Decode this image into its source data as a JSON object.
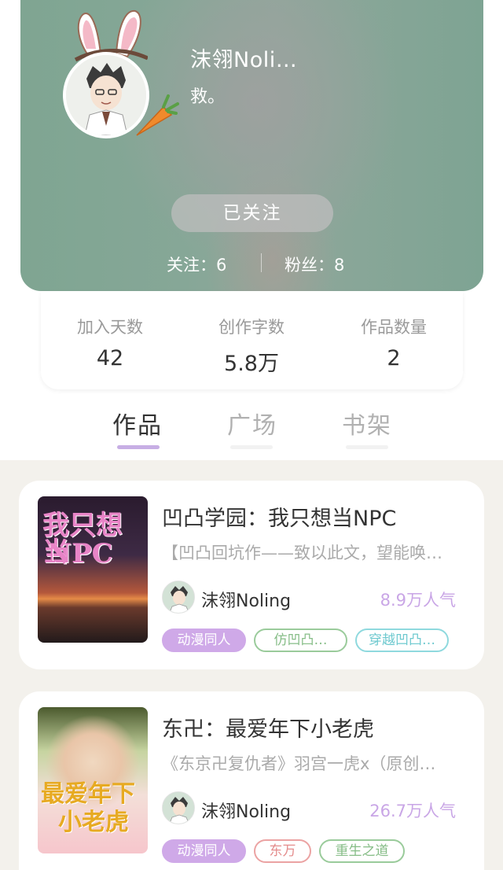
{
  "profile": {
    "name": "沫翎Noli…",
    "bio": "救。",
    "follow_button": "已关注",
    "following_text": "关注：6",
    "fans_text": "粉丝：8"
  },
  "stats": {
    "days_label": "加入天数",
    "days_value": "42",
    "words_label": "创作字数",
    "words_value": "5.8万",
    "works_label": "作品数量",
    "works_value": "2"
  },
  "tabs": [
    {
      "label": "作品",
      "active": true
    },
    {
      "label": "广场",
      "active": false
    },
    {
      "label": "书架",
      "active": false
    }
  ],
  "books": [
    {
      "title": "凹凸学园：我只想当NPC",
      "description": "【凹凸回坑作——致以此文，望能唤…",
      "author": "沫翎Noling",
      "popularity": "8.9万人气",
      "cover_text_1": "我只想当",
      "cover_text_2": "NPC",
      "tags": [
        "动漫同人",
        "仿凹凸…",
        "穿越凹凸…"
      ]
    },
    {
      "title": "东卍：最爱年下小老虎",
      "description": "《东京卍复仇者》羽宫一虎x（原创…",
      "author": "沫翎Noling",
      "popularity": "26.7万人气",
      "cover_text_1": "最爱年下",
      "cover_text_2": "小老虎",
      "tags": [
        "动漫同人",
        "东万",
        "重生之道"
      ]
    }
  ],
  "colors": {
    "header_green": "#86a797",
    "accent_purple": "#c7aee4",
    "popularity_purple": "#c9a6e6",
    "tag_filled": "#cfa9e8",
    "tag_green": "#9acb9b",
    "tag_cyan": "#8fd9de",
    "tag_red": "#eba3a3"
  }
}
